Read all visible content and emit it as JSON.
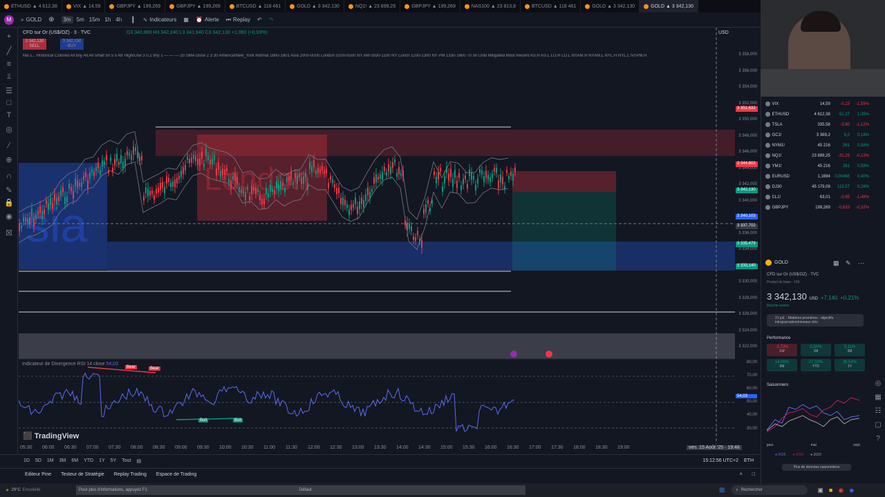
{
  "tabs": [
    {
      "label": "ETHUSD ▲ 4 612,38",
      "active": false
    },
    {
      "label": "VIX ▲ 14,59",
      "active": false
    },
    {
      "label": "GBPJPY ▲ 199,269",
      "active": false
    },
    {
      "label": "GBPJPY ▲ 199,269",
      "active": false
    },
    {
      "label": "BTCUSD ▲ 118 461",
      "active": false
    },
    {
      "label": "GOLD ▲ 3 342,130",
      "active": false
    },
    {
      "label": "NQ1! ▲ 23 899,25",
      "active": false
    },
    {
      "label": "GBPJPY ▲ 199,269",
      "active": false
    },
    {
      "label": "NAS100 ▲ 23 813,8",
      "active": false
    },
    {
      "label": "BTCUSD ▲ 118 461",
      "active": false
    },
    {
      "label": "GOLD ▲ 3 342,130",
      "active": false
    },
    {
      "label": "GOLD ▲ 3 342,130",
      "active": true
    }
  ],
  "toolbar": {
    "avatar": "M",
    "symbol": "GOLD",
    "intervals": [
      "3m",
      "5m",
      "15m",
      "1h",
      "4h"
    ],
    "indicators": "Indicateurs",
    "alert": "Alerte",
    "replay": "Replay"
  },
  "chart": {
    "title": "CFD sur Or (US$/OZ) · 3 · TVC",
    "ohlc": "O3 340,880 H3 342,240 L3 341,940 C3 342,130 +1,060 (+0,03%)",
    "sell_price": "3 342,130",
    "sell_label": "SELL",
    "buy_price": "3 342,130",
    "buy_label": "BUY",
    "indicator_line": "Ma s... Historical Colored All tiny All All small 50 5 5 Atr High/Low 3 0,1 tiny 1 — — — 20 SMA close 2 3 30 America/New_York Normal 1800-1801 Asia 2000-0000 London 0200-0500 NY AM 0930-1100 NY Lunch 1200-1300 NY PM 1330-1600 70 50 Until Mitigated Most Recent AS.H AS.L LO.H LO.L NYAM.H NYAM.L NYL.H NYL.L NYPM.H",
    "watermark_session": "London",
    "watermark_asia": "sia",
    "rsi_label": "Indicateur de Divergence RSI 14 close",
    "rsi_value": "54,03",
    "bear_label": "Bear",
    "bull_label": "Bull",
    "logo": "TradingView",
    "currency": "USD"
  },
  "price_axis": [
    "3 358,000",
    "3 356,000",
    "3 354,000",
    "3 352,000",
    "3 350,000",
    "3 348,000",
    "3 346,000",
    "3 344,000",
    "3 342,000",
    "3 340,000",
    "3 338,000",
    "3 336,000",
    "3 334,000",
    "3 332,000",
    "3 330,000",
    "3 328,000",
    "3 326,000",
    "3 324,000",
    "3 322,000"
  ],
  "price_badges": [
    {
      "label": "3 351,632",
      "color": "#f23645"
    },
    {
      "label": "3 344,802",
      "color": "#f23645"
    },
    {
      "label": "3 342,130",
      "color": "#089981"
    },
    {
      "label": "3 340,103",
      "color": "#2962ff"
    },
    {
      "label": "3 337,702",
      "color": "#363a45"
    },
    {
      "label": "3 335,479",
      "color": "#089981"
    },
    {
      "label": "3 333,140",
      "color": "#089981"
    }
  ],
  "rsi_axis": [
    "80,00",
    "70,00",
    "60,00",
    "54,03",
    "50,00",
    "40,00",
    "30,00"
  ],
  "time_axis": [
    "05:30",
    "06:00",
    "06:30",
    "07:00",
    "07:30",
    "08:00",
    "08:30",
    "09:00",
    "09:30",
    "10:00",
    "10:30",
    "11:00",
    "11:30",
    "12:00",
    "12:30",
    "13:00",
    "13:30",
    "14:00",
    "14:30",
    "15:00",
    "15:30",
    "16:00",
    "16:30",
    "17:00",
    "17:30",
    "18:00",
    "18:30",
    "19:00"
  ],
  "time_cursor": "ven. 15 Août '25 · 19:48",
  "ranges": [
    "1D",
    "5D",
    "1M",
    "3M",
    "6M",
    "YTD",
    "1Y",
    "5Y",
    "Tout"
  ],
  "clock": "15:12:56 UTC+2",
  "eth_label": "ETH",
  "panel_tabs": [
    "Editeur Pine",
    "Testeur de Stratégie",
    "Replay Trading",
    "Espace de Trading"
  ],
  "watchlist": [
    {
      "sym": "VIX",
      "last": "14,59",
      "chg": "-0,23",
      "pct": "-1,55%",
      "dir": "neg"
    },
    {
      "sym": "ETHUSD",
      "last": "4 612,38",
      "chg": "61,27",
      "pct": "1,35%",
      "dir": "pos"
    },
    {
      "sym": "TSLA",
      "last": "335,58",
      "chg": "-3,80",
      "pct": "-1,12%",
      "dir": "neg"
    },
    {
      "sym": "GC1!",
      "last": "3 389,2",
      "chg": "6,0",
      "pct": "0,18%",
      "dir": "pos"
    },
    {
      "sym": "NYM1!",
      "last": "45 216",
      "chg": "261",
      "pct": "0,58%",
      "dir": "pos"
    },
    {
      "sym": "NQ1!",
      "last": "23 899,25",
      "chg": "-31,25",
      "pct": "-0,13%",
      "dir": "neg"
    },
    {
      "sym": "YM1!",
      "last": "45 216",
      "chg": "261",
      "pct": "0,58%",
      "dir": "pos"
    },
    {
      "sym": "EURUSD",
      "last": "1,1694",
      "chg": "0,00466",
      "pct": "0,40%",
      "dir": "pos"
    },
    {
      "sym": "DJ30",
      "last": "45 179,09",
      "chg": "115,57",
      "pct": "0,26%",
      "dir": "pos"
    },
    {
      "sym": "CL1!",
      "last": "63,01",
      "chg": "-0,95",
      "pct": "-1,49%",
      "dir": "neg"
    },
    {
      "sym": "GBPJPY",
      "last": "199,269",
      "chg": "-0,633",
      "pct": "-0,32%",
      "dir": "neg"
    }
  ],
  "details": {
    "symbol": "GOLD",
    "name": "CFD sur Or (US$/OZ) · TVC",
    "type": "Produit de base · Cfd",
    "price": "3 342,130",
    "currency": "USD",
    "change": "+7,140",
    "change_pct": "+0,21%",
    "market_status": "Marché ouvert",
    "news": "21 juil. · Matières premières : objectifs intrajournaliers/niveaux clés",
    "performance_title": "Performance",
    "perf": [
      {
        "v": "-1,73%",
        "p": "1W",
        "dir": "neg"
      },
      {
        "v": "0,50%",
        "p": "1M",
        "dir": "pos"
      },
      {
        "v": "3,11%",
        "p": "3M",
        "dir": "pos"
      },
      {
        "v": "14,06%",
        "p": "6M",
        "dir": "pos"
      },
      {
        "v": "27,33%",
        "p": "YTD",
        "dir": "pos"
      },
      {
        "v": "36,54%",
        "p": "1Y",
        "dir": "pos"
      }
    ],
    "seasonals_title": "Saisonniers",
    "season_months": [
      "janv.",
      "mai",
      "sept."
    ],
    "season_years": [
      "2025",
      "2024",
      "2023"
    ],
    "season_more": "Plus de données saisonnières"
  },
  "taskbar": {
    "weather_temp": "29°C",
    "weather_desc": "Ensoleillé",
    "hint": "Pour plus d'informations, appuyez F1",
    "default_label": "Défaut",
    "search": "Rechercher"
  },
  "colors": {
    "bg": "#131722",
    "up": "#089981",
    "down": "#f23645",
    "blue": "#2962ff",
    "rsi": "#5b6cf0"
  }
}
